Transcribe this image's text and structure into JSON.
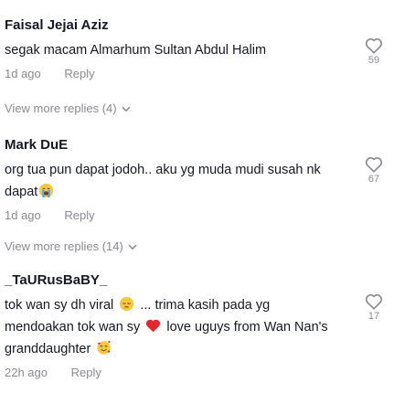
{
  "comments": [
    {
      "username": "Faisal Jejai Aziz",
      "text": "segak macam Almarhum Sultan Abdul Halim",
      "time": "1d ago",
      "reply_label": "Reply",
      "likes": "59",
      "view_more": "View more replies (4)"
    },
    {
      "username": "Mark DuE",
      "text_1": "org tua pun dapat jodoh.. aku yg muda mudi susah nk",
      "text_2": "dapat",
      "emoji_1": "crying-face-emoji",
      "time": "1d ago",
      "reply_label": "Reply",
      "likes": "67",
      "view_more": "View more replies (14)"
    },
    {
      "username": "_TaURusBaBY_",
      "text_1": "tok wan sy dh viral",
      "text_2": "... trima kasih pada yg",
      "text_3": "mendoakan tok wan sy",
      "text_4": "love uguys from Wan Nan's",
      "text_5": "granddaughter",
      "emoji_1": "pensive-face-emoji",
      "emoji_2": "red-heart-emoji",
      "emoji_3": "smiling-face-with-hearts-emoji",
      "time": "22h ago",
      "reply_label": "Reply",
      "likes": "17"
    }
  ],
  "colors": {
    "text": "#161823",
    "secondary": "#8a8b91",
    "heart_outline": "#8a8b91"
  }
}
